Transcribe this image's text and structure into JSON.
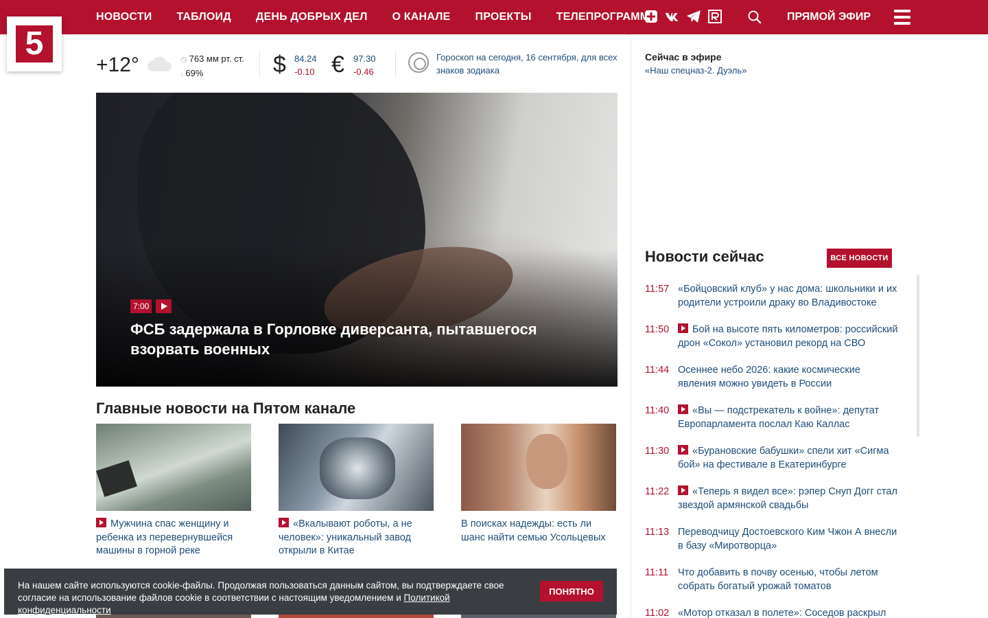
{
  "nav": {
    "items": [
      "НОВОСТИ",
      "ТАБЛОИД",
      "ДЕНЬ ДОБРЫХ ДЕЛ",
      "О КАНАЛЕ",
      "ПРОЕКТЫ",
      "ТЕЛЕПРОГРАММА"
    ],
    "live_label": "ПРЯМОЙ ЭФИР",
    "social_icons": [
      "plus-square-icon",
      "vk-icon",
      "telegram-icon",
      "rutube-icon"
    ]
  },
  "logo": {
    "text": "5"
  },
  "weather": {
    "temp": "+12°",
    "pressure": "763 мм рт. ст.",
    "humidity": "69%"
  },
  "currency": {
    "usd": {
      "symbol": "$",
      "value": "84.24",
      "delta": "-0.10"
    },
    "eur": {
      "symbol": "€",
      "value": "97.30",
      "delta": "-0.46"
    }
  },
  "horoscope": {
    "text": "Гороскоп на сегодня, 16 сентября, для всех знаков зодиака"
  },
  "hero": {
    "time": "7:00",
    "title": "ФСБ задержала в Горловке диверсанта, пытавшегося взорвать военных"
  },
  "main": {
    "title": "Главные новости на Пятом канале",
    "cards": [
      {
        "text": "Мужчина спас женщину и ребенка из перевернувшейся машины в горной реке",
        "video": true
      },
      {
        "text": "«Вкалывают роботы, а не человек»: уникальный завод открыли в Китае",
        "video": true
      },
      {
        "text": "В поисках надежды: есть ли шанс найти семью Усольцевых",
        "video": false
      }
    ]
  },
  "onair": {
    "label": "Сейчас в эфире",
    "show": "«Наш спецназ-2. Дуэль»"
  },
  "news_now": {
    "title": "Новости сейчас",
    "all_label": "ВСЕ НОВОСТИ",
    "items": [
      {
        "time": "11:57",
        "text": "«Бойцовский клуб» у нас дома: школьники и их родители устроили драку во Владивостоке",
        "video": false
      },
      {
        "time": "11:50",
        "text": "Бой на высоте пять километров: российский дрон «Сокол» установил рекорд на СВО",
        "video": true
      },
      {
        "time": "11:44",
        "text": "Осеннее небо 2026: какие космические явления можно увидеть в России",
        "video": false
      },
      {
        "time": "11:40",
        "text": "«Вы — подстрекатель к войне»: депутат Европарламента послал Каю Каллас",
        "video": true
      },
      {
        "time": "11:30",
        "text": "«Бурановские бабушки» спели хит «Сигма бой» на фестивале в Екатеринбурге",
        "video": true
      },
      {
        "time": "11:22",
        "text": "«Теперь я видел все»: рэпер Снуп Догг стал звездой армянской свадьбы",
        "video": true
      },
      {
        "time": "11:13",
        "text": "Переводчицу Достоевского Ким Чжон А внесли в базу «Миротворца»",
        "video": false
      },
      {
        "time": "11:11",
        "text": "Что добавить в почву осенью, чтобы летом собрать богатый урожай томатов",
        "video": false
      },
      {
        "time": "11:02",
        "text": "«Мотор отказал в полете»: Соседов раскрыл",
        "video": false
      }
    ]
  },
  "cookie": {
    "message": "На нашем сайте используются cookie-файлы. Продолжая пользоваться данным сайтом, вы подтверждаете свое согласие на использование файлов cookie в соответствии с настоящим уведомлением и",
    "link": "Политикой конфиденциальности",
    "button": "ПОНЯТНО"
  },
  "colors": {
    "brand": "#b3112e",
    "link": "#1f4e79",
    "cookie_bg": "#3a3d42"
  }
}
